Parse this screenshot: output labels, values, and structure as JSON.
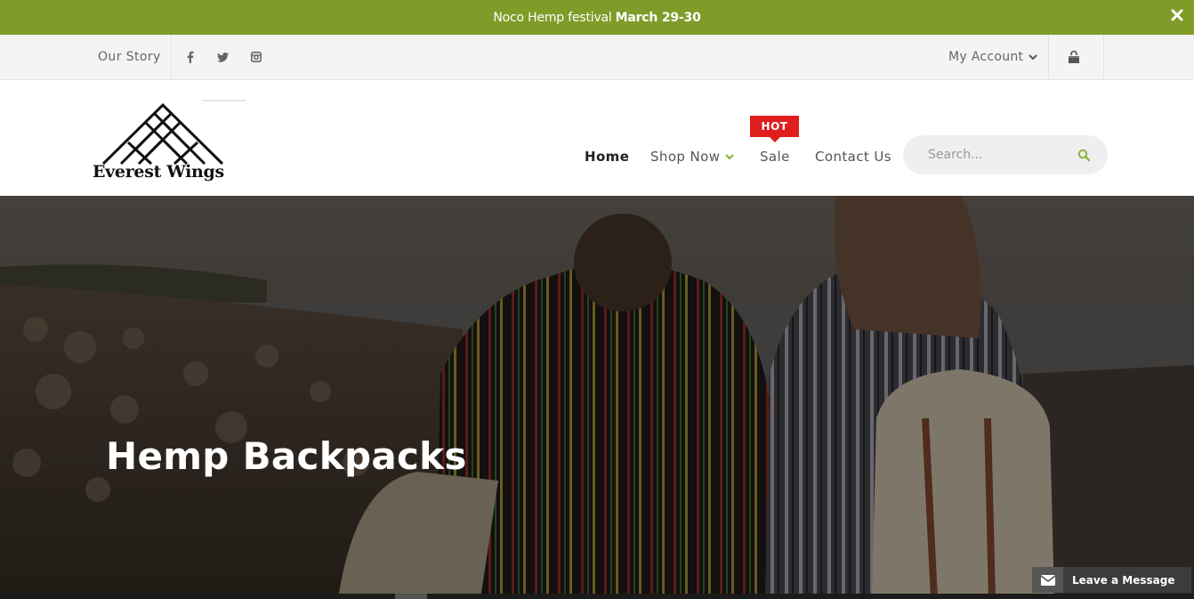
{
  "announcement": {
    "text": "Noco Hemp festival",
    "highlight": "March 29-30",
    "close_icon": "close-icon"
  },
  "topbar": {
    "our_story": "Our Story",
    "social": [
      "facebook-icon",
      "twitter-icon",
      "instagram-icon"
    ],
    "account_label": "My Account",
    "cart_icon": "shopping-bag-icon"
  },
  "header": {
    "logo_text": "Everest Wings",
    "nav": [
      {
        "label": "Home",
        "active": true
      },
      {
        "label": "Shop Now",
        "has_dropdown": true
      },
      {
        "label": "Sale",
        "badge": "HOT"
      },
      {
        "label": "Contact Us"
      }
    ],
    "search_placeholder": "Search..."
  },
  "hero": {
    "title": "Hemp Backpacks"
  },
  "chat": {
    "label": "Leave a Message"
  },
  "colors": {
    "brand_green": "#7f9c29",
    "hot_red": "#e01e1e",
    "search_icon": "#8bb33a"
  }
}
